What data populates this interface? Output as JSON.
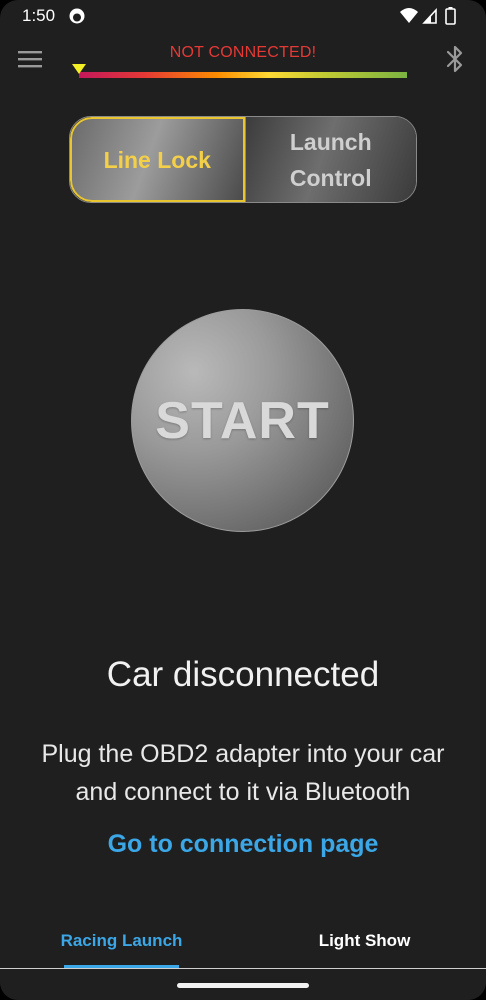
{
  "status_bar": {
    "time": "1:50"
  },
  "header": {
    "connection_status": "NOT CONNECTED!",
    "connection_status_color": "#e53935"
  },
  "mode_toggle": {
    "options": [
      {
        "label": "Line Lock",
        "active": true
      },
      {
        "label": "Launch Control",
        "active": false
      }
    ]
  },
  "start_button": {
    "label": "START"
  },
  "main": {
    "car_status": "Car disconnected",
    "instructions": "Plug the OBD2 adapter into your car and connect to it via Bluetooth",
    "connection_link": "Go to connection page"
  },
  "tabs": [
    {
      "label": "Racing Launch",
      "selected": true
    },
    {
      "label": "Light Show",
      "selected": false
    }
  ],
  "colors": {
    "accent_blue": "#3ba7e6",
    "active_gold": "#f4d048",
    "background": "#1f1f20"
  },
  "icons": {
    "menu": "menu-icon",
    "bluetooth": "bluetooth-icon",
    "wifi": "wifi-icon",
    "signal": "signal-icon",
    "battery": "battery-icon"
  }
}
